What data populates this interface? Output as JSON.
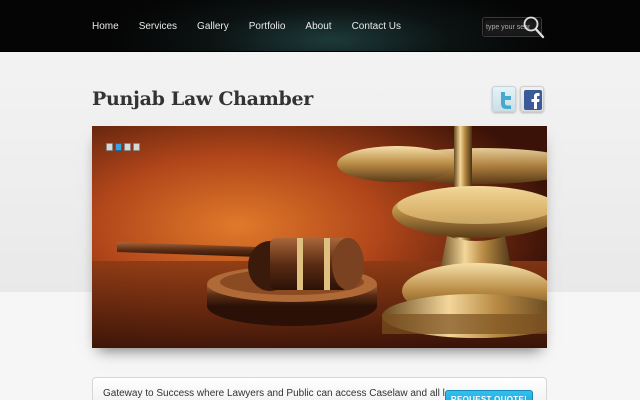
{
  "nav": {
    "items": [
      "Home",
      "Services",
      "Gallery",
      "Portfolio",
      "About",
      "Contact Us"
    ]
  },
  "search": {
    "placeholder": "type your search"
  },
  "header": {
    "title": "Punjab Law Chamber"
  },
  "social": {
    "twitter_icon": "twitter-icon",
    "facebook_icon": "facebook-icon"
  },
  "slider": {
    "slide_count": 4,
    "active_slide": 2
  },
  "tagbar": {
    "text": "Gateway to Success where Lawyers and Public can access Caselaw and all laws",
    "button_label": "REQUEST QUOTE!"
  },
  "colors": {
    "accent": "#2bb3e8",
    "nav_bg": "#050505",
    "title": "#333333"
  }
}
